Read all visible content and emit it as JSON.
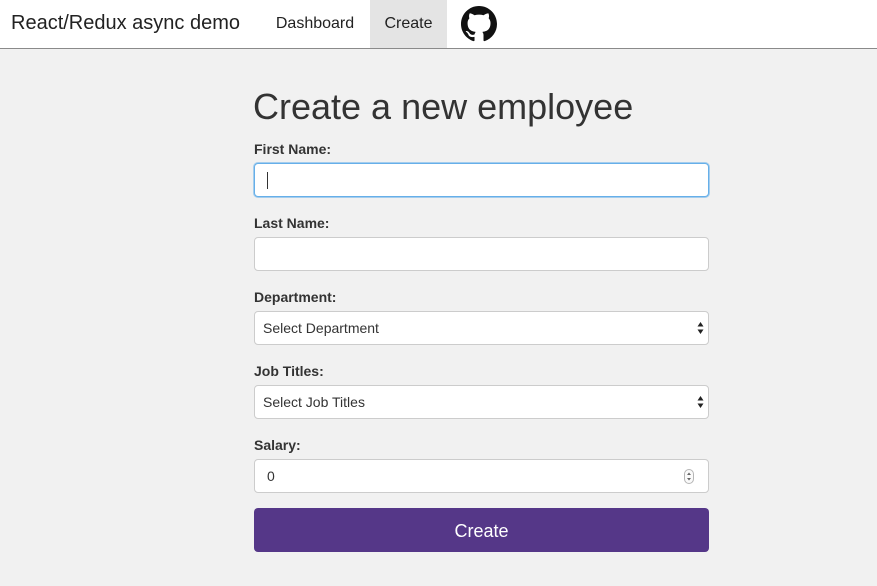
{
  "navbar": {
    "brand": "React/Redux async demo",
    "links": [
      {
        "label": "Dashboard",
        "active": false
      },
      {
        "label": "Create",
        "active": true
      }
    ],
    "github_icon": "github-icon"
  },
  "form": {
    "title": "Create a new employee",
    "first_name": {
      "label": "First Name:",
      "value": ""
    },
    "last_name": {
      "label": "Last Name:",
      "value": ""
    },
    "department": {
      "label": "Department:",
      "selected": "Select Department"
    },
    "job_titles": {
      "label": "Job Titles:",
      "selected": "Select Job Titles"
    },
    "salary": {
      "label": "Salary:",
      "value": "0"
    },
    "submit_label": "Create"
  },
  "colors": {
    "accent": "#553788",
    "background": "#f1f1f1",
    "focus": "#66afe9",
    "active_tab": "#e4e4e4"
  }
}
